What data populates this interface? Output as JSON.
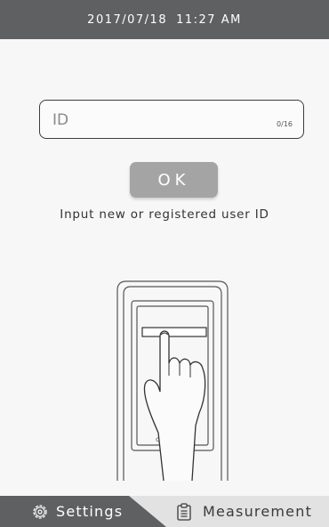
{
  "status_bar": {
    "date": "2017/07/18",
    "time": "11:27 AM"
  },
  "id_input": {
    "placeholder": "ID",
    "value": "",
    "counter": "0/16"
  },
  "ok_button": {
    "label": "OK"
  },
  "instruction": "Input new or registered user ID",
  "illustration": {
    "brand_text": "chor"
  },
  "bottom_nav": {
    "tabs": [
      {
        "label": "Settings",
        "icon": "gear-icon",
        "active": true
      },
      {
        "label": "Measurement",
        "icon": "clipboard-icon",
        "active": false
      }
    ]
  },
  "colors": {
    "bar": "#5f6062",
    "button": "#a4a4a4",
    "background": "#f7f7f7"
  }
}
